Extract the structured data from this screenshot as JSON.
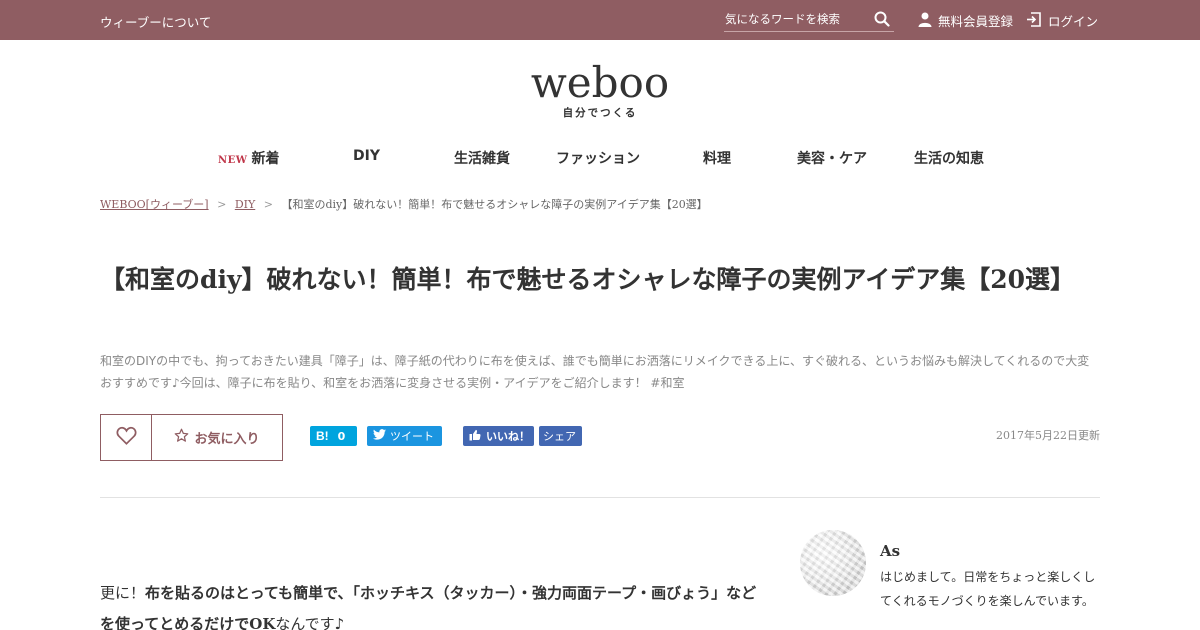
{
  "topbar": {
    "about": "ウィーブーについて",
    "search_placeholder": "気になるワードを検索",
    "register": "無料会員登録",
    "login": "ログイン"
  },
  "logo": {
    "word": "weboo",
    "tagline": "自分でつくる"
  },
  "nav": {
    "new_badge": "NEW",
    "items": [
      "新着",
      "DIY",
      "生活雑貨",
      "ファッション",
      "料理",
      "美容・ケア",
      "生活の知恵"
    ]
  },
  "breadcrumb": {
    "home": "WEBOO[ウィーブー]",
    "category": "DIY",
    "current": "【和室のdiy】破れない！簡単！布で魅せるオシャレな障子の実例アイデア集【20選】",
    "separator": ">"
  },
  "article": {
    "title": "【和室のdiy】破れない！簡単！布で魅せるオシャレな障子の実例アイデア集【20選】",
    "lead": "和室のDIYの中でも、拘っておきたい建具「障子」は、障子紙の代わりに布を使えば、誰でも簡単にお洒落にリメイクできる上に、すぐ破れる、というお悩みも解決してくれるので大変おすすめです♪今回は、障子に布を貼り、和室をお洒落に変身させる実例・アイデアをご紹介します！ #和室",
    "favorite_label": "お気に入り",
    "updated": "2017年5月22日更新",
    "body_prefix": "更に！",
    "body_bold": "布を貼るのはとっても簡単で、「ホッチキス（タッカー）・強力両面テープ・画びょう」などを使ってとめるだけでOK",
    "body_suffix": "なんです♪"
  },
  "social": {
    "hatena_count": "0",
    "tweet": "ツイート",
    "like": "いいね！",
    "share": "シェア"
  },
  "author": {
    "name": "As",
    "bio": "はじめまして。日常をちょっと楽しくしてくれるモノづくりを楽しんでいます。"
  },
  "colors": {
    "brand": "#8f5d62",
    "new_badge": "#c0374a",
    "hatena": "#00a4de",
    "twitter": "#1b95e0",
    "facebook": "#4267b2"
  }
}
